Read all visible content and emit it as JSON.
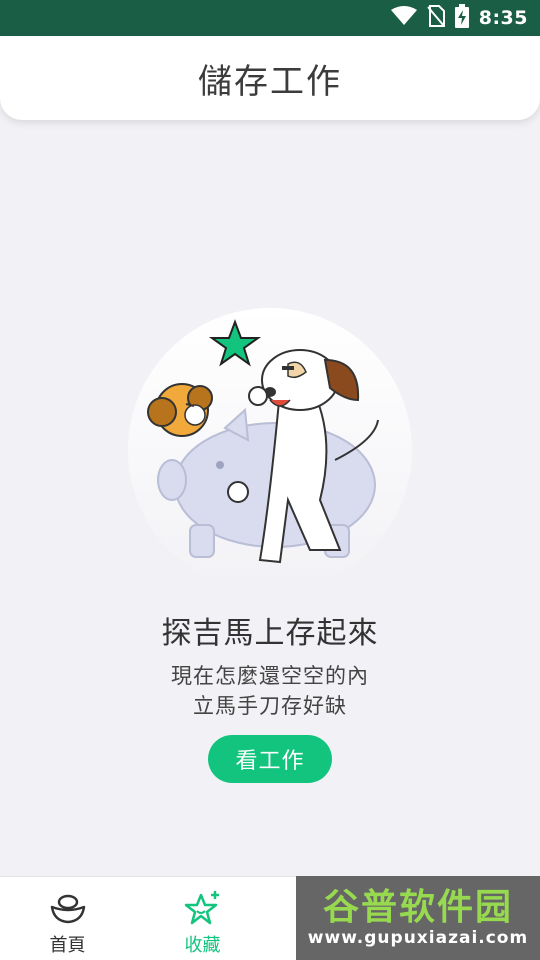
{
  "status_bar": {
    "time": "8:35",
    "icons": [
      "wifi-icon",
      "no-sim-icon",
      "battery-charging-icon"
    ]
  },
  "header": {
    "title": "儲存工作"
  },
  "empty_state": {
    "title": "探吉馬上存起來",
    "line1": "現在怎麼還空空的內",
    "line2": "立馬手刀存好缺",
    "button_label": "看工作"
  },
  "bottom_nav": {
    "items": [
      {
        "label": "首頁",
        "icon": "ingot-icon",
        "active": false
      },
      {
        "label": "收藏",
        "icon": "star-icon",
        "active": true
      }
    ]
  },
  "watermark": {
    "title": "谷普软件园",
    "url": "www.gupuxiazai.com"
  },
  "colors": {
    "accent": "#12c47e",
    "status_bar": "#1b5e46"
  }
}
